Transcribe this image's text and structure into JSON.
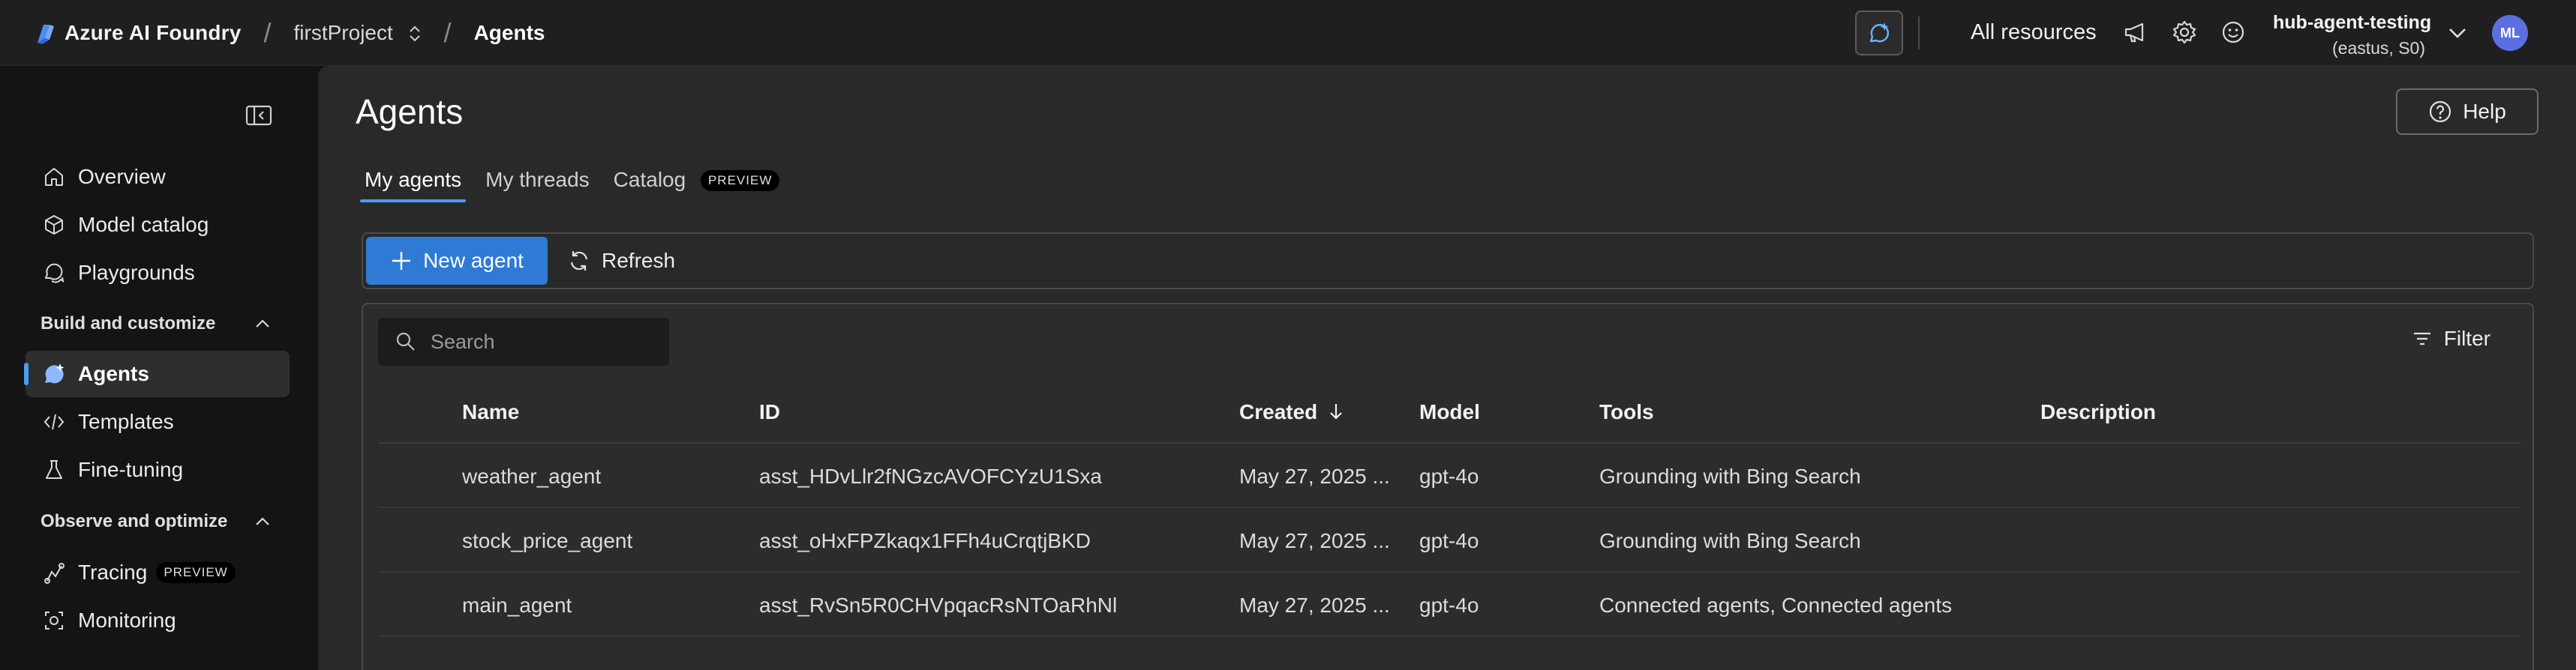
{
  "header": {
    "brand": "Azure AI Foundry",
    "project": "firstProject",
    "current_page": "Agents",
    "all_resources": "All resources",
    "hub_name": "hub-agent-testing",
    "hub_region": "(eastus, S0)",
    "avatar_initials": "ML",
    "accent_color": "#479ef5"
  },
  "sidebar": {
    "items_top": [
      {
        "label": "Overview",
        "icon": "home-icon"
      },
      {
        "label": "Model catalog",
        "icon": "cube-icon"
      },
      {
        "label": "Playgrounds",
        "icon": "chat-icon"
      }
    ],
    "section_build": "Build and customize",
    "items_build": [
      {
        "label": "Agents",
        "icon": "agent-icon",
        "active": true
      },
      {
        "label": "Templates",
        "icon": "code-icon"
      },
      {
        "label": "Fine-tuning",
        "icon": "flask-icon"
      }
    ],
    "section_observe": "Observe and optimize",
    "items_observe": [
      {
        "label": "Tracing",
        "icon": "tracing-icon",
        "badge": "PREVIEW"
      },
      {
        "label": "Monitoring",
        "icon": "monitor-icon"
      }
    ]
  },
  "main": {
    "title": "Agents",
    "help_label": "Help",
    "tabs": [
      {
        "label": "My agents",
        "active": true
      },
      {
        "label": "My threads"
      },
      {
        "label": "Catalog",
        "badge": "PREVIEW"
      }
    ],
    "toolbar": {
      "new_agent_label": "New agent",
      "refresh_label": "Refresh"
    },
    "search": {
      "placeholder": "Search"
    },
    "filter_label": "Filter",
    "table": {
      "columns": [
        "Name",
        "ID",
        "Created",
        "Model",
        "Tools",
        "Description"
      ],
      "rows": [
        {
          "name": "weather_agent",
          "id": "asst_HDvLlr2fNGzcAVOFCYzU1Sxa",
          "created": "May 27, 2025 ...",
          "model": "gpt-4o",
          "tools": "Grounding with Bing Search",
          "description": ""
        },
        {
          "name": "stock_price_agent",
          "id": "asst_oHxFPZkaqx1FFh4uCrqtjBKD",
          "created": "May 27, 2025 ...",
          "model": "gpt-4o",
          "tools": "Grounding with Bing Search",
          "description": ""
        },
        {
          "name": "main_agent",
          "id": "asst_RvSn5R0CHVpqacRsNTOaRhNl",
          "created": "May 27, 2025 ...",
          "model": "gpt-4o",
          "tools": "Connected agents, Connected agents",
          "description": ""
        }
      ]
    }
  }
}
